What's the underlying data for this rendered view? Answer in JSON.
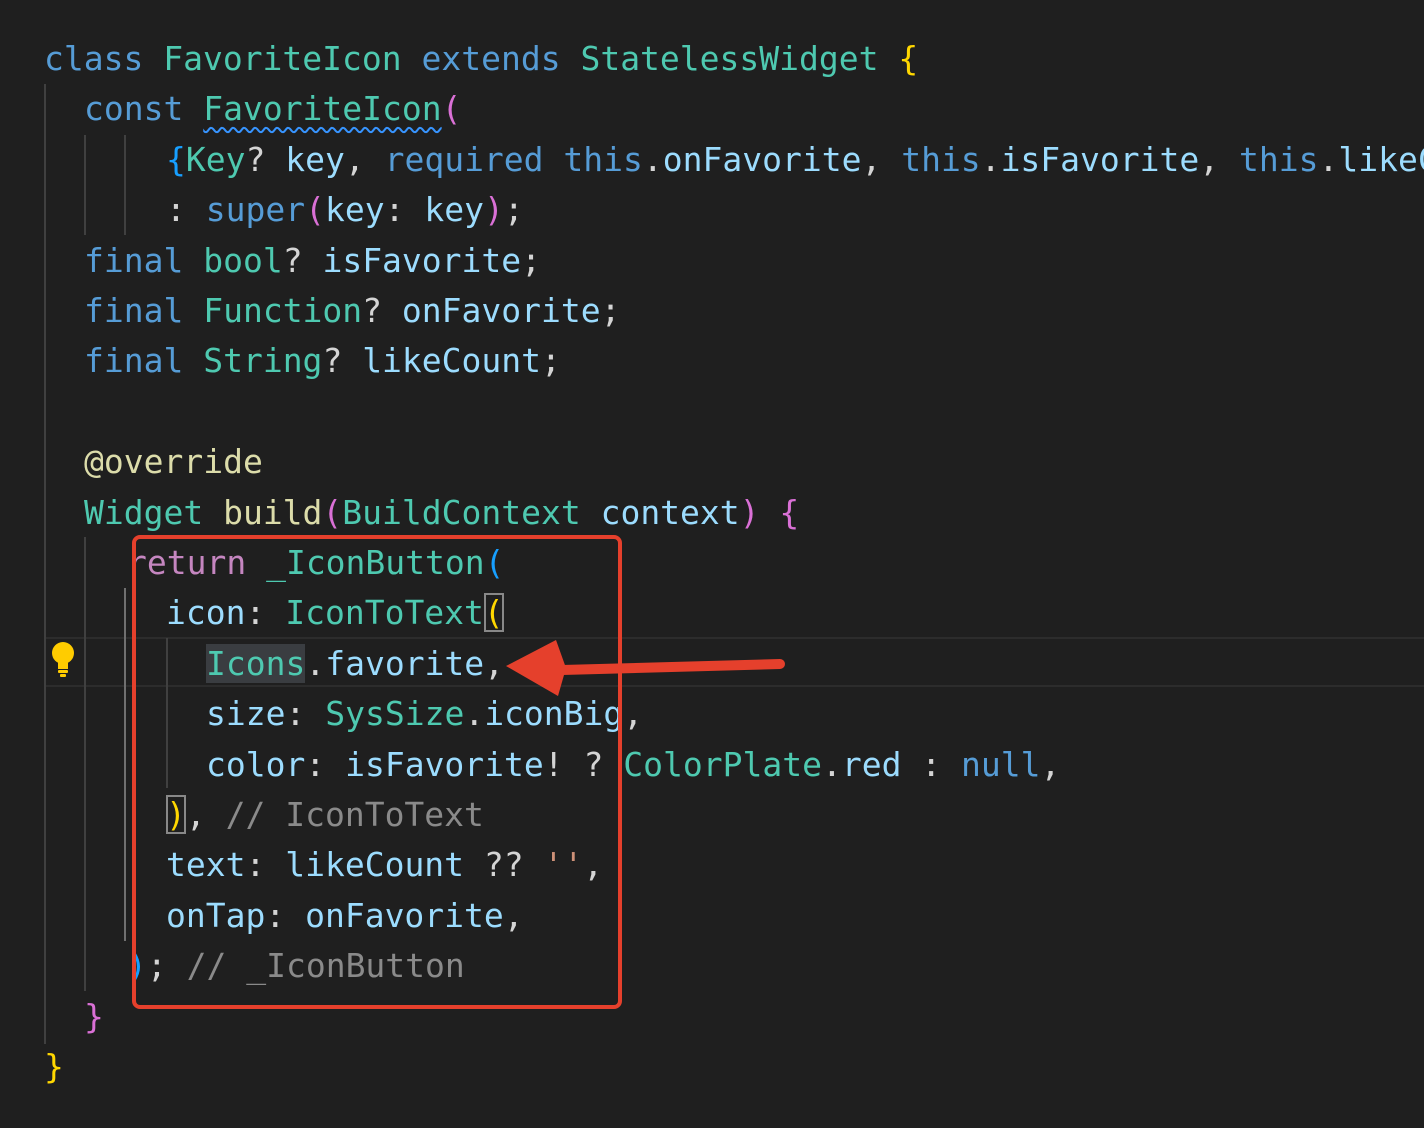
{
  "theme": {
    "background": "#1f1f1f",
    "accent_annotation": "#e5402c",
    "syntax": {
      "keyword": "#569cd6",
      "type": "#4ec9b0",
      "variable": "#9cdcfe",
      "function": "#dcdcaa",
      "control": "#c586c0",
      "plain": "#d4d4d4",
      "comment": "#8a8a8a",
      "string": "#ce9178",
      "bracket_gold": "#ffd700",
      "bracket_pink": "#da70d6",
      "bracket_blue": "#179fff"
    }
  },
  "editor": {
    "lightbulb_icon": "lightbulb-icon",
    "annotation": {
      "box": "red-highlight-box",
      "arrow": "red-arrow-icon"
    },
    "lines": [
      [
        {
          "t": "class ",
          "c": "keyword"
        },
        {
          "t": "FavoriteIcon ",
          "c": "type"
        },
        {
          "t": "extends ",
          "c": "keyword"
        },
        {
          "t": "StatelessWidget ",
          "c": "type"
        },
        {
          "t": "{",
          "c": "bracket_gold"
        }
      ],
      [
        {
          "t": "const ",
          "c": "keyword"
        },
        {
          "t": "FavoriteIcon",
          "c": "type",
          "squiggle": true
        },
        {
          "t": "(",
          "c": "bracket_pink"
        }
      ],
      [
        {
          "t": "{",
          "c": "bracket_blue"
        },
        {
          "t": "Key",
          "c": "type"
        },
        {
          "t": "? ",
          "c": "plain"
        },
        {
          "t": "key",
          "c": "variable"
        },
        {
          "t": ", ",
          "c": "plain"
        },
        {
          "t": "required ",
          "c": "keyword"
        },
        {
          "t": "this",
          "c": "keyword"
        },
        {
          "t": ".",
          "c": "plain"
        },
        {
          "t": "onFavorite",
          "c": "variable"
        },
        {
          "t": ", ",
          "c": "plain"
        },
        {
          "t": "this",
          "c": "keyword"
        },
        {
          "t": ".",
          "c": "plain"
        },
        {
          "t": "isFavorite",
          "c": "variable"
        },
        {
          "t": ", ",
          "c": "plain"
        },
        {
          "t": "this",
          "c": "keyword"
        },
        {
          "t": ".",
          "c": "plain"
        },
        {
          "t": "likeCount",
          "c": "variable"
        }
      ],
      [
        {
          "t": ": ",
          "c": "plain"
        },
        {
          "t": "super",
          "c": "keyword"
        },
        {
          "t": "(",
          "c": "bracket_pink"
        },
        {
          "t": "key",
          "c": "variable"
        },
        {
          "t": ": ",
          "c": "plain"
        },
        {
          "t": "key",
          "c": "variable"
        },
        {
          "t": ")",
          "c": "bracket_pink"
        },
        {
          "t": ";",
          "c": "plain"
        }
      ],
      [
        {
          "t": "final ",
          "c": "keyword"
        },
        {
          "t": "bool",
          "c": "type"
        },
        {
          "t": "? ",
          "c": "plain"
        },
        {
          "t": "isFavorite",
          "c": "variable"
        },
        {
          "t": ";",
          "c": "plain"
        }
      ],
      [
        {
          "t": "final ",
          "c": "keyword"
        },
        {
          "t": "Function",
          "c": "type"
        },
        {
          "t": "? ",
          "c": "plain"
        },
        {
          "t": "onFavorite",
          "c": "variable"
        },
        {
          "t": ";",
          "c": "plain"
        }
      ],
      [
        {
          "t": "final ",
          "c": "keyword"
        },
        {
          "t": "String",
          "c": "type"
        },
        {
          "t": "? ",
          "c": "plain"
        },
        {
          "t": "likeCount",
          "c": "variable"
        },
        {
          "t": ";",
          "c": "plain"
        }
      ],
      [],
      [
        {
          "t": "@override",
          "c": "function"
        }
      ],
      [
        {
          "t": "Widget ",
          "c": "type"
        },
        {
          "t": "build",
          "c": "function"
        },
        {
          "t": "(",
          "c": "bracket_pink"
        },
        {
          "t": "BuildContext ",
          "c": "type"
        },
        {
          "t": "context",
          "c": "variable"
        },
        {
          "t": ") ",
          "c": "bracket_pink"
        },
        {
          "t": "{",
          "c": "bracket_pink"
        }
      ],
      [
        {
          "t": "return ",
          "c": "control"
        },
        {
          "t": "_IconButton",
          "c": "type"
        },
        {
          "t": "(",
          "c": "bracket_blue"
        }
      ],
      [
        {
          "t": "icon",
          "c": "variable"
        },
        {
          "t": ": ",
          "c": "plain"
        },
        {
          "t": "IconToText",
          "c": "type"
        },
        {
          "t": "(",
          "c": "bracket_gold",
          "box": true
        }
      ],
      [
        {
          "t": "Icons",
          "c": "type",
          "hl": true
        },
        {
          "t": ".",
          "c": "plain"
        },
        {
          "t": "favorite",
          "c": "variable"
        },
        {
          "t": ",",
          "c": "plain"
        }
      ],
      [
        {
          "t": "size",
          "c": "variable"
        },
        {
          "t": ": ",
          "c": "plain"
        },
        {
          "t": "SysSize",
          "c": "type"
        },
        {
          "t": ".",
          "c": "plain"
        },
        {
          "t": "iconBig",
          "c": "variable"
        },
        {
          "t": ",",
          "c": "plain"
        }
      ],
      [
        {
          "t": "color",
          "c": "variable"
        },
        {
          "t": ": ",
          "c": "plain"
        },
        {
          "t": "isFavorite",
          "c": "variable"
        },
        {
          "t": "! ? ",
          "c": "plain"
        },
        {
          "t": "ColorPlate",
          "c": "type"
        },
        {
          "t": ".",
          "c": "plain"
        },
        {
          "t": "red",
          "c": "variable"
        },
        {
          "t": " : ",
          "c": "plain"
        },
        {
          "t": "null",
          "c": "keyword"
        },
        {
          "t": ",",
          "c": "plain"
        }
      ],
      [
        {
          "t": ")",
          "c": "bracket_gold",
          "box": true
        },
        {
          "t": ", ",
          "c": "plain"
        },
        {
          "t": "// IconToText",
          "c": "comment"
        }
      ],
      [
        {
          "t": "text",
          "c": "variable"
        },
        {
          "t": ": ",
          "c": "plain"
        },
        {
          "t": "likeCount",
          "c": "variable"
        },
        {
          "t": " ?? ",
          "c": "plain"
        },
        {
          "t": "''",
          "c": "string"
        },
        {
          "t": ",",
          "c": "plain"
        }
      ],
      [
        {
          "t": "onTap",
          "c": "variable"
        },
        {
          "t": ": ",
          "c": "plain"
        },
        {
          "t": "onFavorite",
          "c": "variable"
        },
        {
          "t": ",",
          "c": "plain"
        }
      ],
      [
        {
          "t": ")",
          "c": "bracket_blue"
        },
        {
          "t": "; ",
          "c": "plain"
        },
        {
          "t": "// _IconButton",
          "c": "comment"
        }
      ],
      [
        {
          "t": "}",
          "c": "bracket_pink"
        }
      ],
      [
        {
          "t": "}",
          "c": "bracket_gold"
        }
      ]
    ]
  }
}
